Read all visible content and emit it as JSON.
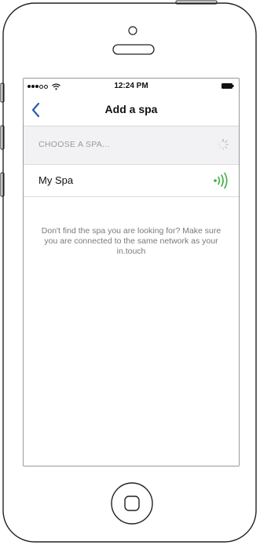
{
  "status_bar": {
    "time": "12:24 PM"
  },
  "nav": {
    "back_icon": "chevron-left-icon",
    "title": "Add a spa"
  },
  "spa_list": {
    "header": "CHOOSE A SPA...",
    "loading_icon": "spinner-icon",
    "items": [
      {
        "name": "My Spa",
        "icon": "wifi-signal-icon"
      }
    ]
  },
  "help": {
    "text": "Don't find the spa you are looking for? Make sure you are connected to the same network as your in.touch"
  },
  "colors": {
    "accent": "#2a5aa8",
    "signal_green": "#3fae3f",
    "section_bg": "#f2f2f4",
    "muted_text": "#9a9a9a"
  }
}
